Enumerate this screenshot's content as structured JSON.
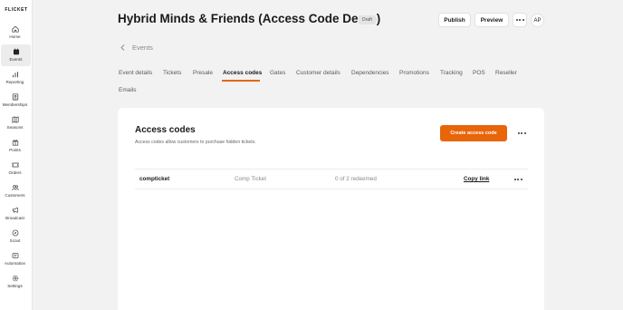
{
  "app": {
    "logo": "FLICKET",
    "accent_color": "#e8650a"
  },
  "sidebar": {
    "items": [
      {
        "label": "Home",
        "icon": "home-icon"
      },
      {
        "label": "Events",
        "icon": "calendar-icon",
        "active": true
      },
      {
        "label": "Reporting",
        "icon": "bar-chart-icon"
      },
      {
        "label": "Memberships",
        "icon": "id-card-icon"
      },
      {
        "label": "Seasons",
        "icon": "map-icon"
      },
      {
        "label": "Points",
        "icon": "gift-icon"
      },
      {
        "label": "Orders",
        "icon": "ticket-icon"
      },
      {
        "label": "Customers",
        "icon": "users-icon"
      },
      {
        "label": "Broadcast",
        "icon": "megaphone-icon"
      },
      {
        "label": "Scout",
        "icon": "compass-icon"
      },
      {
        "label": "Automation",
        "icon": "automation-icon"
      },
      {
        "label": "Settings",
        "icon": "gear-icon"
      }
    ]
  },
  "header": {
    "title": "Hybrid Minds & Friends (Access Code Demo)",
    "status_badge": "Draft",
    "publish_label": "Publish",
    "preview_label": "Preview",
    "avatar_initials": "AP"
  },
  "breadcrumb": {
    "label": "Events"
  },
  "tabs": [
    {
      "label": "Event details"
    },
    {
      "label": "Tickets"
    },
    {
      "label": "Presale"
    },
    {
      "label": "Access codes",
      "active": true
    },
    {
      "label": "Gates"
    },
    {
      "label": "Customer details"
    },
    {
      "label": "Dependencies"
    },
    {
      "label": "Promotions"
    },
    {
      "label": "Tracking"
    },
    {
      "label": "POS"
    },
    {
      "label": "Reseller"
    },
    {
      "label": "Emails"
    }
  ],
  "access_codes": {
    "title": "Access codes",
    "subtitle": "Access codes allow customers to purchase hidden tickets.",
    "create_label": "Create access code",
    "rows": [
      {
        "code": "compticket",
        "ticket_type": "Comp Ticket",
        "redeemed": "0 of 2 redeemed",
        "copy_label": "Copy link"
      }
    ]
  }
}
